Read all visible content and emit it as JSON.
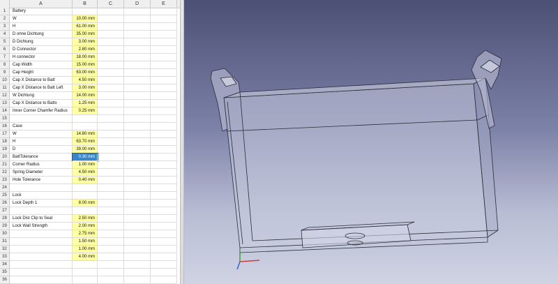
{
  "spreadsheet": {
    "columns": [
      "A",
      "B",
      "C",
      "D",
      "E"
    ],
    "rows": [
      {
        "num": "1",
        "label": "Battery",
        "value": ""
      },
      {
        "num": "2",
        "label": "W",
        "value": "10.00 mm"
      },
      {
        "num": "3",
        "label": "H",
        "value": "61.00 mm"
      },
      {
        "num": "4",
        "label": "D ohne Dichtung",
        "value": "35.00 mm"
      },
      {
        "num": "5",
        "label": "D Dichtung",
        "value": "3.00 mm"
      },
      {
        "num": "6",
        "label": "D Connector",
        "value": "2.80 mm"
      },
      {
        "num": "7",
        "label": "H connector",
        "value": "18.00 mm"
      },
      {
        "num": "8",
        "label": "Cap Width",
        "value": "15.00 mm"
      },
      {
        "num": "9",
        "label": "Cap Height",
        "value": "63.00 mm"
      },
      {
        "num": "10",
        "label": "Cap X Distance to Batt",
        "value": "4.50 mm"
      },
      {
        "num": "11",
        "label": "Cap X Distance to Batt Left",
        "value": "3.00 mm"
      },
      {
        "num": "12",
        "label": "W Dichtung",
        "value": "14.00 mm"
      },
      {
        "num": "13",
        "label": "Cap X Distance to Battx",
        "value": "1.25 mm"
      },
      {
        "num": "14",
        "label": "Inner Corner Chamfer Radius",
        "value": "0.25 mm"
      },
      {
        "num": "15",
        "label": "",
        "value": ""
      },
      {
        "num": "16",
        "label": "Case",
        "value": ""
      },
      {
        "num": "17",
        "label": "W",
        "value": "14.80 mm"
      },
      {
        "num": "18",
        "label": "H",
        "value": "63.70 mm"
      },
      {
        "num": "19",
        "label": "D",
        "value": "39.00 mm"
      },
      {
        "num": "20",
        "label": "BattTolerance",
        "value": "0.30 mm",
        "selected": true
      },
      {
        "num": "21",
        "label": "Corner Radius",
        "value": "1.00 mm"
      },
      {
        "num": "22",
        "label": "Spring Diameter",
        "value": "4.50 mm"
      },
      {
        "num": "23",
        "label": "Hole Tolerance",
        "value": "0.40 mm"
      },
      {
        "num": "24",
        "label": "",
        "value": ""
      },
      {
        "num": "25",
        "label": "Lock",
        "value": ""
      },
      {
        "num": "26",
        "label": "Lock Depth 1",
        "value": "8.00 mm"
      },
      {
        "num": "27",
        "label": "",
        "value": ""
      },
      {
        "num": "28",
        "label": "Lock Dist Clip to Seal",
        "value": "2.50 mm"
      },
      {
        "num": "29",
        "label": "Lock Wall Strength",
        "value": "2.00 mm"
      },
      {
        "num": "30",
        "label": "",
        "value": "2.75 mm"
      },
      {
        "num": "31",
        "label": "",
        "value": "1.50 mm"
      },
      {
        "num": "32",
        "label": "",
        "value": "1.00 mm"
      },
      {
        "num": "33",
        "label": "",
        "value": "4.00 mm"
      },
      {
        "num": "34",
        "label": "",
        "value": ""
      },
      {
        "num": "35",
        "label": "",
        "value": ""
      },
      {
        "num": "36",
        "label": "",
        "value": ""
      }
    ]
  },
  "colors": {
    "filled_cell": "#ffffa4",
    "selected_cell": "#3a86c7",
    "viewport_top": "#4d5075",
    "viewport_bottom": "#cfd3e3"
  }
}
